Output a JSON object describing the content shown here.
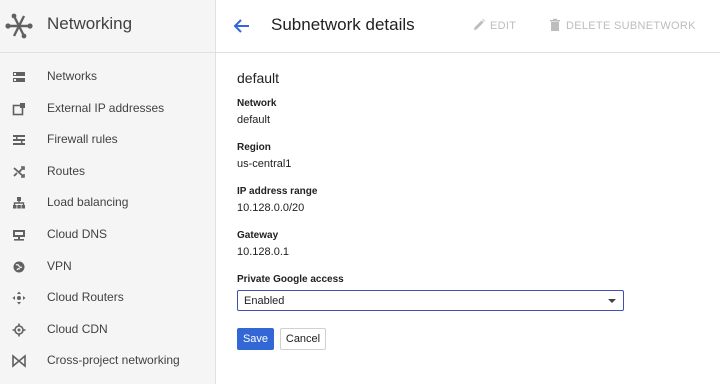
{
  "app": {
    "title": "Networking"
  },
  "sidebar": {
    "items": [
      {
        "label": "Networks",
        "icon": "networks-icon"
      },
      {
        "label": "External IP addresses",
        "icon": "external-ip-icon"
      },
      {
        "label": "Firewall rules",
        "icon": "firewall-icon"
      },
      {
        "label": "Routes",
        "icon": "routes-icon"
      },
      {
        "label": "Load balancing",
        "icon": "load-balancing-icon"
      },
      {
        "label": "Cloud DNS",
        "icon": "dns-icon"
      },
      {
        "label": "VPN",
        "icon": "vpn-icon"
      },
      {
        "label": "Cloud Routers",
        "icon": "routers-icon"
      },
      {
        "label": "Cloud CDN",
        "icon": "cdn-icon"
      },
      {
        "label": "Cross-project networking",
        "icon": "cross-project-icon"
      }
    ]
  },
  "header": {
    "title": "Subnetwork details",
    "edit_label": "EDIT",
    "delete_label": "DELETE SUBNETWORK"
  },
  "subnet": {
    "name": "default",
    "fields": [
      {
        "label": "Network",
        "value": "default"
      },
      {
        "label": "Region",
        "value": "us-central1"
      },
      {
        "label": "IP address range",
        "value": "10.128.0.0/20"
      },
      {
        "label": "Gateway",
        "value": "10.128.0.1"
      }
    ],
    "private_access": {
      "label": "Private Google access",
      "value": "Enabled"
    }
  },
  "actions": {
    "save_label": "Save",
    "cancel_label": "Cancel"
  },
  "colors": {
    "accent": "#3367d6",
    "select_border": "#3f51b5",
    "disabled": "#bdbdbd",
    "sidebar_bg": "#f5f5f5"
  }
}
